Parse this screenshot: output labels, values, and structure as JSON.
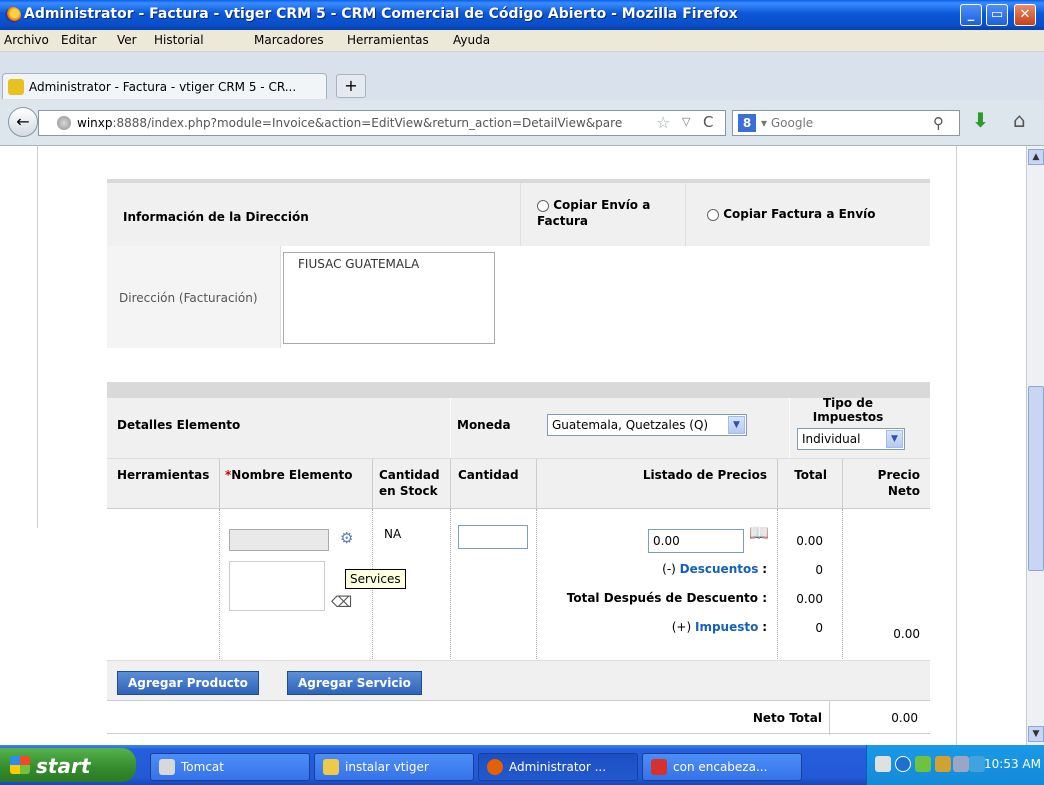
{
  "window": {
    "title": "Administrator - Factura - vtiger CRM 5 - CRM Comercial de Código Abierto - Mozilla Firefox",
    "min": "_",
    "max": "▭",
    "close": "✕"
  },
  "menu": [
    "Archivo",
    "Editar",
    "Ver",
    "Historial",
    "Marcadores",
    "Herramientas",
    "Ayuda"
  ],
  "tab": {
    "label": "Administrator - Factura - vtiger CRM 5 - CR...",
    "new": "+"
  },
  "nav": {
    "back": "←",
    "url_host": "winxp",
    "url_rest": ":8888/index.php?module=Invoice&action=EditView&return_action=DetailView&pare",
    "star": "☆",
    "dropdown": "▽",
    "reload": "C",
    "search_engine_letter": "8",
    "search_placeholder": "▾ Google",
    "search_icon": "⚲",
    "download": "⬇",
    "home": "⌂"
  },
  "address": {
    "title": "Información de la Dirección",
    "copy_shipping_to_billing": "Copiar Envío a Factura",
    "copy_billing_to_shipping": "Copiar Factura a Envío",
    "billing_label": "Dirección (Facturación)",
    "billing_value": "FIUSAC GUATEMALA"
  },
  "items": {
    "title": "Detalles Elemento",
    "currency_label": "Moneda",
    "currency_value": "Guatemala, Quetzales (Q)",
    "tax_type_label": "Tipo de Impuestos",
    "tax_type_value": "Individual",
    "columns": {
      "tools": "Herramientas",
      "name_required": "*",
      "name": "Nombre Elemento",
      "stock": "Cantidad en Stock",
      "qty": "Cantidad",
      "price_list": "Listado de Precios",
      "total": "Total",
      "net_price": "Precio Neto"
    },
    "row": {
      "stock_value": "NA",
      "price_value": "0.00",
      "tooltip": "Services",
      "discount_prefix": "(-) ",
      "discount_link": "Descuentos",
      "colon": ":",
      "after_discount": "Total Después de Descuento :",
      "tax_prefix": "(+) ",
      "tax_link": "Impuesto",
      "total_value": "0.00",
      "discount_value": "0",
      "after_discount_value": "0.00",
      "tax_value": "0",
      "net_value": "0.00"
    },
    "add_product": "Agregar Producto",
    "add_service": "Agregar Servicio",
    "net_total_label": "Neto Total",
    "net_total_value": "0.00"
  },
  "taskbar": {
    "start": "start",
    "items": [
      "Tomcat",
      "instalar vtiger",
      "Administrator ...",
      "con encabeza..."
    ],
    "clock": "10:53 AM"
  }
}
